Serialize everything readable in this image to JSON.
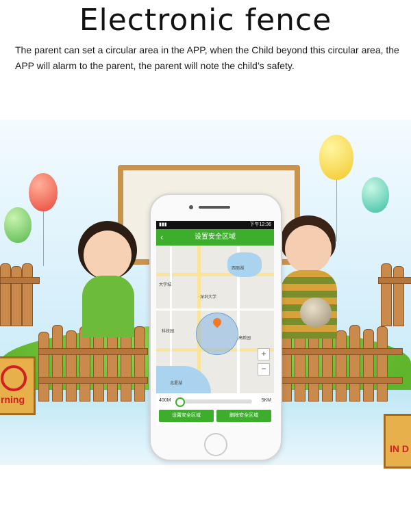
{
  "headline": "Electronic fence",
  "description": "The parent can set a circular area in the APP, when the Child beyond this circular area, the APP will alarm to the parent, the parent will note the child’s safety.",
  "phone": {
    "status_time": "下午12:36",
    "screen_title": "设置安全区域",
    "back_icon": "chevron-left-icon",
    "map_labels": [
      "大学城",
      "西丽湖",
      "北星湖",
      "高新园",
      "深圳大学",
      "科技园"
    ],
    "slider_min": "400M",
    "slider_max": "5KM",
    "zoom_in": "+",
    "zoom_out": "−",
    "set_button": "设置安全区域",
    "delete_button": "删除安全区域"
  },
  "signs": {
    "left": "rning",
    "right": "IN D"
  },
  "colors": {
    "app_green": "#3cae2c",
    "fence_fill": "#6aa0d8",
    "pin": "#f07a2a"
  }
}
